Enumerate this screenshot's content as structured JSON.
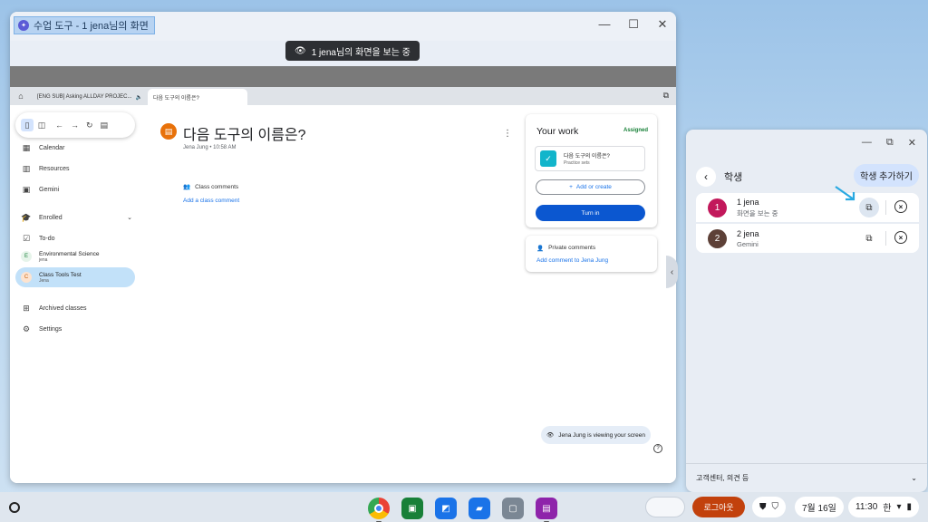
{
  "viewer": {
    "title": "수업 도구 - 1 jena님의 화면",
    "banner": "1 jena님의 화면을 보는 중",
    "tabs": [
      "[ENG SUB] Asking ALLDAY PROJEC...",
      "다음 도구의 이름은?"
    ]
  },
  "sidebar": {
    "items": [
      "Calendar",
      "Resources",
      "Gemini"
    ],
    "enrolled": "Enrolled",
    "todo": "To-do",
    "courses": [
      {
        "name": "Environmental Science",
        "sub": "jena",
        "letter": "E"
      },
      {
        "name": "Class Tools Test",
        "sub": "Jena",
        "letter": "C"
      }
    ],
    "archived": "Archived classes",
    "settings": "Settings"
  },
  "assignment": {
    "title": "다음 도구의 이름은?",
    "meta": "Jena Jung • 10:58 AM",
    "class_comments": "Class comments",
    "add_class_comment": "Add a class comment"
  },
  "your_work": {
    "title": "Your work",
    "status": "Assigned",
    "item_name": "다음 도구의 이름은?",
    "item_sub": "Practice sets",
    "add_create": "Add or create",
    "turn_in": "Turn in"
  },
  "private_comments": {
    "label": "Private comments",
    "add": "Add comment to Jena Jung"
  },
  "viewing_chip": "Jena Jung is viewing your screen",
  "panel": {
    "title": "학생",
    "add_button": "학생 추가하기",
    "students": [
      {
        "number": "1",
        "name": "1 jena",
        "status": "화면을 보는 중",
        "color": "#c2185b"
      },
      {
        "number": "2",
        "name": "2 jena",
        "status": "Gemini",
        "color": "#5d4037"
      }
    ],
    "footer": "고객센터, 의견 등"
  },
  "shelf": {
    "logout": "로그아웃",
    "date": "7월 16일",
    "time": "11:30",
    "ime": "한"
  }
}
